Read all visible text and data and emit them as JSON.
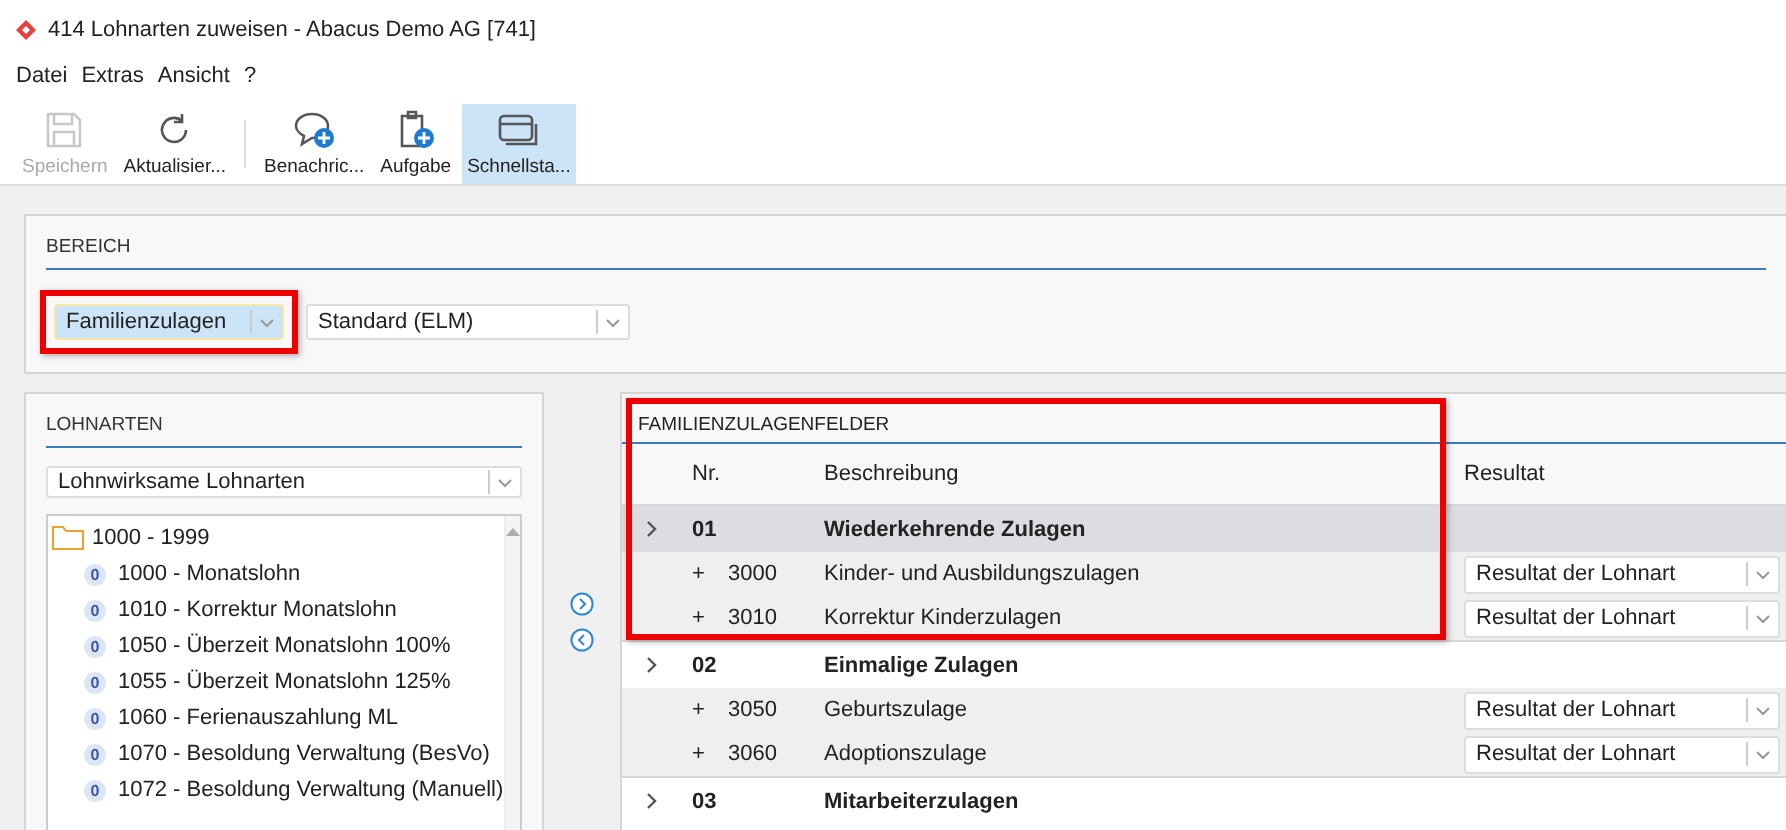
{
  "window": {
    "title": "414 Lohnarten zuweisen - Abacus Demo AG [741]"
  },
  "menu": [
    "Datei",
    "Extras",
    "Ansicht",
    "?"
  ],
  "toolbar": [
    {
      "kind": "save",
      "label": "Speichern",
      "disabled": true,
      "selected": false
    },
    {
      "kind": "refresh",
      "label": "Aktualisier...",
      "disabled": false,
      "selected": false
    },
    {
      "kind": "message",
      "label": "Benachric...",
      "disabled": false,
      "selected": false
    },
    {
      "kind": "task",
      "label": "Aufgabe",
      "disabled": false,
      "selected": false
    },
    {
      "kind": "window",
      "label": "Schnellsta...",
      "disabled": false,
      "selected": true
    }
  ],
  "bereich": {
    "title": "BEREICH",
    "combos": [
      {
        "value": "Familienzulagen",
        "highlighted": true
      },
      {
        "value": "Standard (ELM)",
        "highlighted": false
      }
    ]
  },
  "lohnarten": {
    "title": "LOHNARTEN",
    "filter": "Lohnwirksame Lohnarten",
    "tree": [
      {
        "label": "1000 - 1999",
        "children": [
          {
            "badge": "0",
            "label": "1000 - Monatslohn"
          },
          {
            "badge": "0",
            "label": "1010 - Korrektur Monatslohn"
          },
          {
            "badge": "0",
            "label": "1050 - Überzeit Monatslohn 100%"
          },
          {
            "badge": "0",
            "label": "1055 - Überzeit Monatslohn 125%"
          },
          {
            "badge": "0",
            "label": "1060 - Ferienauszahlung ML"
          },
          {
            "badge": "0",
            "label": "1070 - Besoldung Verwaltung (BesVo)"
          },
          {
            "badge": "0",
            "label": "1072 - Besoldung Verwaltung (Manuell)"
          }
        ]
      }
    ]
  },
  "fields": {
    "title": "FAMILIENZULAGENFELDER",
    "highlighted": true,
    "columns": [
      "Nr.",
      "Beschreibung",
      "Resultat"
    ],
    "groups": [
      {
        "number": "01",
        "title": "Wiederkehrende Zulagen",
        "selected": true,
        "items": [
          {
            "sign": "+",
            "number": "3000",
            "description": "Kinder- und Ausbildungszulagen",
            "result": "Resultat der Lohnart"
          },
          {
            "sign": "+",
            "number": "3010",
            "description": "Korrektur Kinderzulagen",
            "result": "Resultat der Lohnart"
          }
        ]
      },
      {
        "number": "02",
        "title": "Einmalige Zulagen",
        "selected": false,
        "items": [
          {
            "sign": "+",
            "number": "3050",
            "description": "Geburtszulage",
            "result": "Resultat der Lohnart"
          },
          {
            "sign": "+",
            "number": "3060",
            "description": "Adoptionszulage",
            "result": "Resultat der Lohnart"
          }
        ]
      },
      {
        "number": "03",
        "title": "Mitarbeiterzulagen",
        "selected": false
      }
    ]
  }
}
